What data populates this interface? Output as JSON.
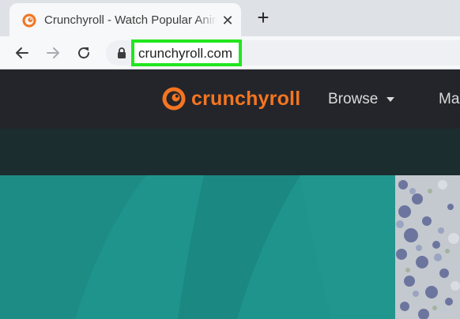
{
  "browser": {
    "tab": {
      "title": "Crunchyroll - Watch Popular Anime",
      "close_glyph": "✕",
      "favicon": "crunchyroll-logo-icon"
    },
    "new_tab_glyph": "+",
    "address_bar": {
      "url": "crunchyroll.com",
      "highlight_color": "#22e61e"
    }
  },
  "site": {
    "logo_text": "crunchyroll",
    "brand_color": "#f47521",
    "nav": {
      "browse_label": "Browse",
      "more_label": "Ma"
    },
    "colors": {
      "header_bg": "#23252b",
      "subbar_bg": "#1c2d30",
      "hero_bg": "#1f948c"
    }
  }
}
